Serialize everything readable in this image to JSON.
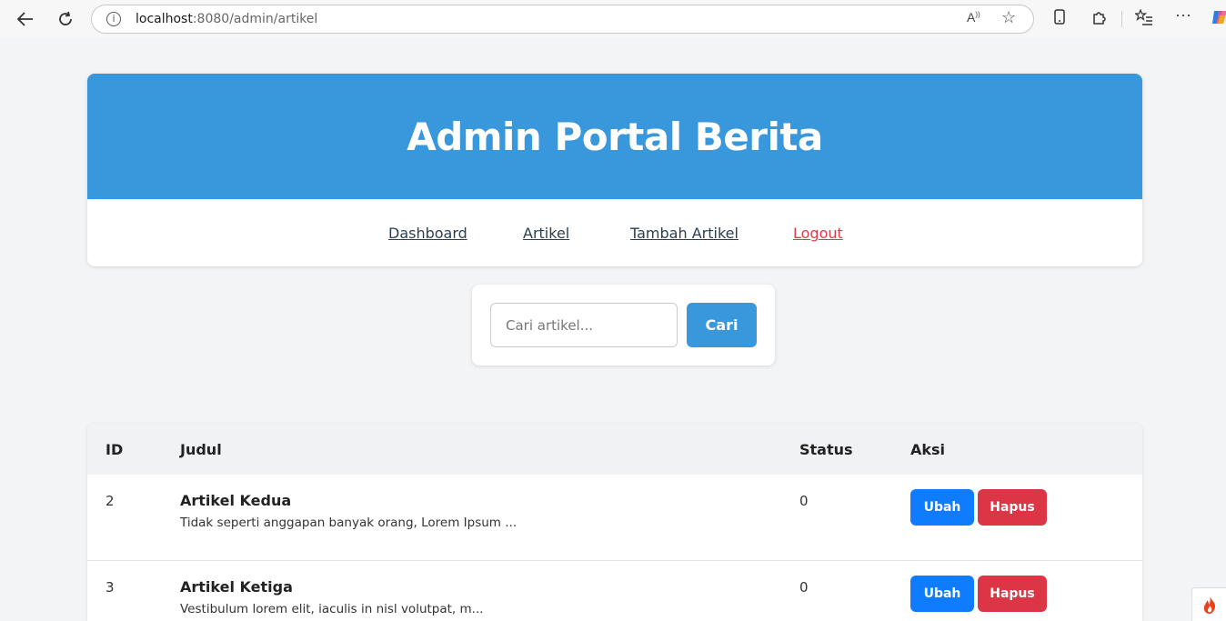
{
  "browser": {
    "url_host": "localhost",
    "url_rest": ":8080/admin/artikel"
  },
  "header": {
    "title": "Admin Portal Berita"
  },
  "nav": {
    "items": [
      {
        "label": "Dashboard"
      },
      {
        "label": "Artikel"
      },
      {
        "label": "Tambah Artikel"
      },
      {
        "label": "Logout"
      }
    ]
  },
  "search": {
    "placeholder": "Cari artikel...",
    "button_label": "Cari"
  },
  "table": {
    "headers": [
      "ID",
      "Judul",
      "Status",
      "Aksi"
    ],
    "rows": [
      {
        "id": "2",
        "title": "Artikel Kedua",
        "excerpt": "Tidak seperti anggapan banyak orang, Lorem Ipsum ...",
        "status": "0",
        "edit": "Ubah",
        "delete": "Hapus"
      },
      {
        "id": "3",
        "title": "Artikel Ketiga",
        "excerpt": "Vestibulum lorem elit, iaculis in nisl volutpat, m...",
        "status": "0",
        "edit": "Ubah",
        "delete": "Hapus"
      }
    ]
  },
  "colors": {
    "primary": "#3898db",
    "edit": "#0f7bff",
    "delete": "#dc3545",
    "logout": "#e03a4a"
  }
}
